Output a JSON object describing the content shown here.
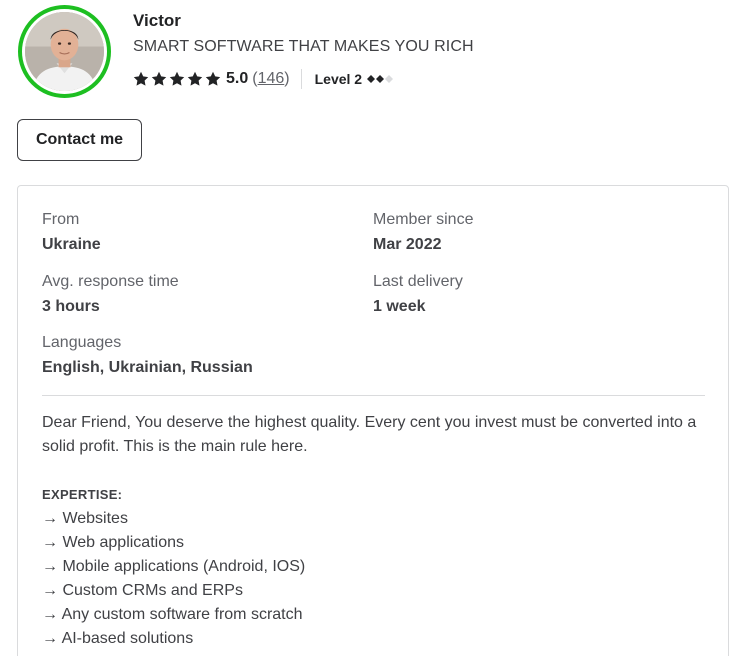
{
  "seller": {
    "name": "Victor",
    "tagline": "SMART SOFTWARE THAT MAKES YOU RICH",
    "rating": {
      "stars": 5,
      "score": "5.0",
      "count_open": "(",
      "count": "146",
      "count_close": ")"
    },
    "level": {
      "label": "Level 2",
      "filled": 2,
      "total": 3
    }
  },
  "contact_button": {
    "label": "Contact me"
  },
  "stats": {
    "from": {
      "label": "From",
      "value": "Ukraine"
    },
    "member_since": {
      "label": "Member since",
      "value": "Mar 2022"
    },
    "avg_response": {
      "label": "Avg. response time",
      "value": "3 hours"
    },
    "last_delivery": {
      "label": "Last delivery",
      "value": "1 week"
    },
    "languages": {
      "label": "Languages",
      "value": "English, Ukrainian, Russian"
    }
  },
  "description": {
    "intro": "Dear Friend, You deserve the highest quality. Every cent you invest must be converted into a solid profit. This is the main rule here.",
    "heading": "EXPERTISE:",
    "items": [
      "→ Websites",
      "→ Web applications",
      "→ Mobile applications (Android, IOS)",
      "→ Custom CRMs and ERPs",
      "→ Any custom software from scratch",
      "→ AI-based solutions"
    ]
  },
  "colors": {
    "online_ring": "#1dbf21",
    "star": "#222325",
    "text_primary": "#404145",
    "text_muted": "#62646a",
    "border": "#dadbdd"
  },
  "icons": {
    "star": "star-icon",
    "level_diamond": "diamond-icon"
  }
}
